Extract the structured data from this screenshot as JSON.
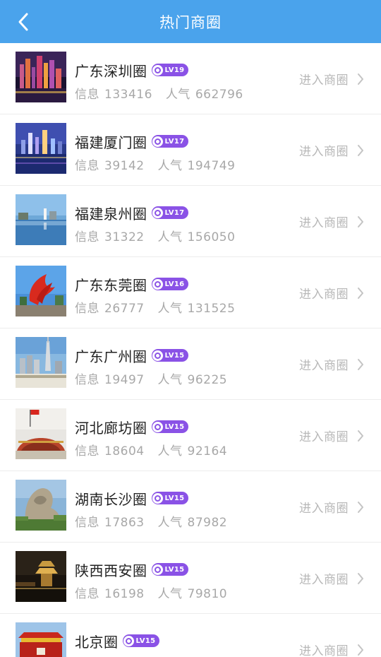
{
  "header": {
    "title": "热门商圈"
  },
  "rows": [
    {
      "name": "广东深圳圈",
      "level": "LV19",
      "info_label": "信息",
      "info": "133416",
      "pop_label": "人气",
      "pop": "662796",
      "enter": "进入商圈"
    },
    {
      "name": "福建厦门圈",
      "level": "LV17",
      "info_label": "信息",
      "info": "39142",
      "pop_label": "人气",
      "pop": "194749",
      "enter": "进入商圈"
    },
    {
      "name": "福建泉州圈",
      "level": "LV17",
      "info_label": "信息",
      "info": "31322",
      "pop_label": "人气",
      "pop": "156050",
      "enter": "进入商圈"
    },
    {
      "name": "广东东莞圈",
      "level": "LV16",
      "info_label": "信息",
      "info": "26777",
      "pop_label": "人气",
      "pop": "131525",
      "enter": "进入商圈"
    },
    {
      "name": "广东广州圈",
      "level": "LV15",
      "info_label": "信息",
      "info": "19497",
      "pop_label": "人气",
      "pop": "96225",
      "enter": "进入商圈"
    },
    {
      "name": "河北廊坊圈",
      "level": "LV15",
      "info_label": "信息",
      "info": "18604",
      "pop_label": "人气",
      "pop": "92164",
      "enter": "进入商圈"
    },
    {
      "name": "湖南长沙圈",
      "level": "LV15",
      "info_label": "信息",
      "info": "17863",
      "pop_label": "人气",
      "pop": "87982",
      "enter": "进入商圈"
    },
    {
      "name": "陕西西安圈",
      "level": "LV15",
      "info_label": "信息",
      "info": "16198",
      "pop_label": "人气",
      "pop": "79810",
      "enter": "进入商圈"
    },
    {
      "name": "北京圈",
      "level": "LV15",
      "info_label": "",
      "info": "",
      "pop_label": "",
      "pop": "",
      "enter": "进入商圈"
    }
  ],
  "colors": {
    "header": "#4aa3ec",
    "badge": "#8a52e6"
  },
  "icons": {
    "back": "chevron-left-icon",
    "row_arrow": "chevron-right-icon",
    "badge": "ring-icon"
  }
}
